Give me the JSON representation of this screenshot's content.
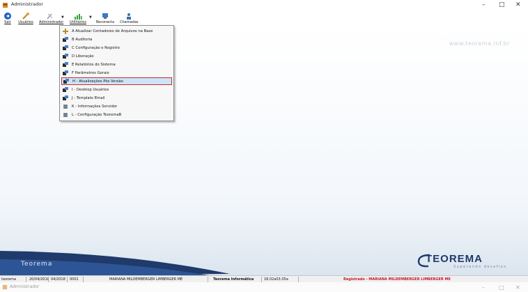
{
  "window": {
    "title": "Administrador",
    "minimize": "–",
    "maximize": "□",
    "close": "✕"
  },
  "toolbar": {
    "buttons": [
      {
        "label": "Sair",
        "icon": "exit-icon"
      },
      {
        "label": "Usuários",
        "icon": "users-icon"
      },
      {
        "label": "Administrador",
        "icon": "admin-tools-icon"
      },
      {
        "label": "Utilitários",
        "icon": "utilities-chart-icon"
      },
      {
        "label": "Reconecta",
        "icon": "reconnect-icon"
      },
      {
        "label": "Chamadas",
        "icon": "calls-icon"
      }
    ]
  },
  "menu": {
    "items": [
      {
        "label": "A Atualizar Contadores de Arquivos na Base",
        "icon": "update-counters-icon"
      },
      {
        "label": "B Auditoria",
        "icon": "module-icon"
      },
      {
        "label": "C Configuração e Registro",
        "icon": "module-icon"
      },
      {
        "label": "D Liberação",
        "icon": "module-icon"
      },
      {
        "label": "E Relatórios do Sistema",
        "icon": "module-icon"
      },
      {
        "label": "F Parâmetros Gerais",
        "icon": "module-icon"
      },
      {
        "label": "H - Atualizações Pós Versão",
        "icon": "module-icon",
        "selected": true
      },
      {
        "label": "I - Desktop Usuários",
        "icon": "module-icon"
      },
      {
        "label": "J - Template Email",
        "icon": "module-icon"
      },
      {
        "label": "K - Informações Servidor",
        "icon": "server-icon"
      },
      {
        "label": "L - Configuração TeoremaB",
        "icon": "server-icon"
      }
    ]
  },
  "content": {
    "watermark": "www.teorema.inf.br",
    "banner_text": "Teorema",
    "logo_name": "TEOREMA",
    "logo_subtitle": "Superando desafios"
  },
  "statusbar": {
    "user": "teorema",
    "date": "20/04/2018",
    "period": "04/2018",
    "code": "0001",
    "company": "MARIANA MILDEMBERGER LIMBERGER ME",
    "vendor": "Teorema Informática",
    "version": "18.02a03.05a",
    "registered": "Registrado - MARIANA MILDEMBERGER LIMBERGER ME"
  },
  "background_window": {
    "title": "Administrador"
  },
  "colors": {
    "menu_selection": "#cfe3f8",
    "selection_border": "#cc2b2b",
    "registered_text": "#c2182a",
    "logo_blue": "#1f3a6b"
  }
}
